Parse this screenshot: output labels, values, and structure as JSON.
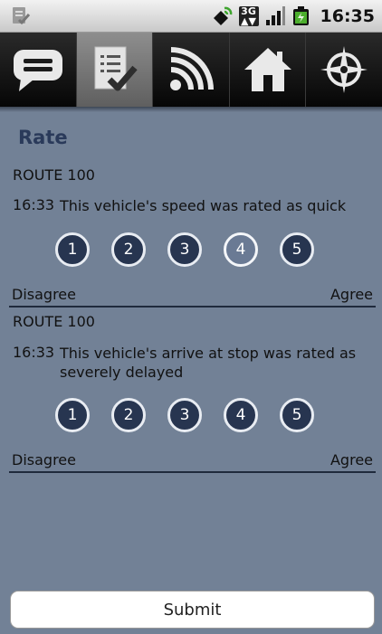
{
  "status_bar": {
    "time": "16:35",
    "icons": [
      "task-notification-icon",
      "gps-icon",
      "3g-icon",
      "signal-icon",
      "battery-icon"
    ],
    "network_badge": "3G"
  },
  "tabs": [
    {
      "name": "messages",
      "icon": "speech-bubble-icon",
      "active": false
    },
    {
      "name": "rate",
      "icon": "checklist-icon",
      "active": true
    },
    {
      "name": "feeds",
      "icon": "rss-icon",
      "active": false
    },
    {
      "name": "home",
      "icon": "home-icon",
      "active": false
    },
    {
      "name": "navigate",
      "icon": "compass-icon",
      "active": false
    }
  ],
  "page": {
    "title": "Rate"
  },
  "ratings": [
    {
      "route": "ROUTE 100",
      "time": "16:33",
      "text": "This vehicle's speed was rated as quick",
      "options": [
        "1",
        "2",
        "3",
        "4",
        "5"
      ],
      "selected": "4",
      "scale_left": "Disagree",
      "scale_right": "Agree"
    },
    {
      "route": "ROUTE 100",
      "time": "16:33",
      "text": "This vehicle's arrive at stop was rated as severely delayed",
      "options": [
        "1",
        "2",
        "3",
        "4",
        "5"
      ],
      "selected": null,
      "scale_left": "Disagree",
      "scale_right": "Agree"
    }
  ],
  "submit_label": "Submit",
  "colors": {
    "background": "#728196",
    "title": "#2a3a5a",
    "rate_button": "#273550",
    "rate_button_selected": "#6a7a94"
  }
}
